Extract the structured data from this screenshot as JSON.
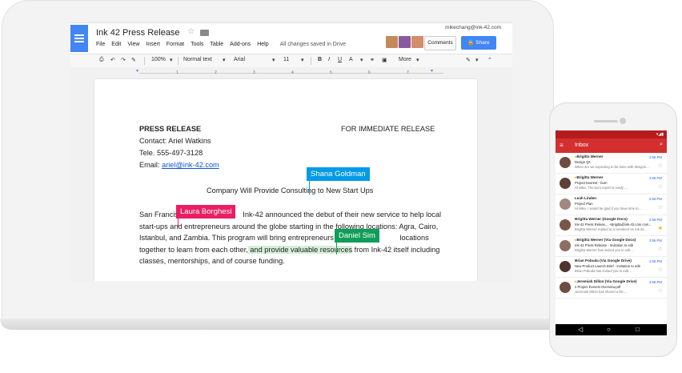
{
  "docs": {
    "title": "Ink 42 Press Release",
    "menu": [
      "File",
      "Edit",
      "View",
      "Insert",
      "Format",
      "Tools",
      "Table",
      "Add-ons",
      "Help"
    ],
    "save_status": "All changes saved in Drive",
    "account": "mikechang@ink-42.com",
    "comments_label": "Comments",
    "share_label": "Share",
    "toolbar": {
      "zoom": "100%",
      "style": "Normal text",
      "font": "Arial",
      "size": "11",
      "more": "More"
    },
    "ruler": [
      "1",
      "2",
      "3",
      "4",
      "5",
      "6",
      "7"
    ]
  },
  "document": {
    "heading_left": "PRESS RELEASE",
    "heading_right": "FOR IMMEDIATE RELEASE",
    "contact": "Contact: Ariel Watkins",
    "tele": "Tele. 555-497-3128",
    "email_label": "Email: ",
    "email_link": "ariel@ink-42.com",
    "subtitle_a": "Company Will Provide Consulting ",
    "subtitle_b": "to New Start Ups",
    "p1_a": "San Francisco",
    "p1_b": " Ink-42 announced the debut of their new service to help local",
    "p2": "start-ups and entrepreneurs around the globe starting in the following locations: Agra, Cairo,",
    "p3_a": "Istanbul, and Zambia. This program will bring entrepreneurs from",
    "p3_b": " locations",
    "p4_a": "together to learn from each other,",
    "p4_hl": " and provide valuable resources",
    "p4_b": " from Ink-42 itself including",
    "p5": "classes, mentorships, and of course funding."
  },
  "collaborators": [
    {
      "name": "Shana Goldman",
      "color": "#039be5"
    },
    {
      "name": "Laura Borghesi",
      "color": "#e91e63"
    },
    {
      "name": "Daniel Sim",
      "color": "#0f9d58"
    }
  ],
  "phone": {
    "app_title": "Inbox",
    "emails": [
      {
        "from": "Brigitta Werner",
        "subject": "Design Qs",
        "snippet": "When are we expecting to be done with designs…",
        "time": "3:56 PM",
        "starred": false,
        "important": true
      },
      {
        "from": "Brigitta Werner",
        "subject": "Project Everest - burn",
        "snippet": "Hi Mike, The burn report is ready …",
        "time": "3:56 PM",
        "starred": false,
        "important": true
      },
      {
        "from": "Leah Linden",
        "subject": "Project Plan",
        "snippet": "Hi Mike, I would be glad if you have time to…",
        "time": "3:56 PM",
        "starred": false,
        "important": false
      },
      {
        "from": "Brigitta Werner (Google Docs)",
        "subject": "Ink-42 Press Releas… +Brigitta@ink-42.com com…",
        "snippet": "Brigitta Werner replied to a comment on Ink-42…",
        "time": "3:56 PM",
        "starred": true,
        "important": false
      },
      {
        "from": "Brigitta Werner (Via Google Docs)",
        "subject": "Ink-42 Press Release - Invitation to edit",
        "snippet": "Brigitta Werner has invited you to edit…",
        "time": "3:56 PM",
        "starred": false,
        "important": true
      },
      {
        "from": "Brian Pobuda (Via Google Drive)",
        "subject": "New Product Launch Brief - Invitation to edit",
        "snippet": "Brian Pobuda has invited you to edit…",
        "time": "3:56 PM",
        "starred": false,
        "important": false
      },
      {
        "from": "Jeremiah Dillon (Via Google Drive)",
        "subject": "2 Project Everest Overview.pdf",
        "snippet": "Jeremiah Dillon has shared a file…",
        "time": "3:56 PM",
        "starred": false,
        "important": true
      }
    ]
  }
}
